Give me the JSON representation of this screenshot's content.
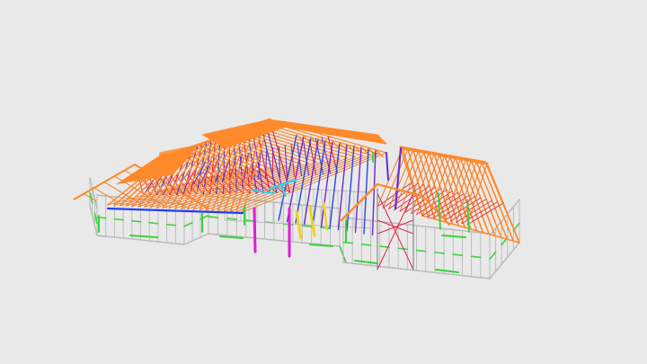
{
  "viewer": {
    "background": "#e9e9e9"
  },
  "colors": {
    "stud": "#b9b9b9",
    "stud_dark": "#8e8e8e",
    "truss_chord": "#f07b2a",
    "truss_top": "#ff8a2b",
    "web_purple": "#6a2bd6",
    "web_blue": "#2948e0",
    "web_red": "#e0234a",
    "brace_green": "#3ad23a",
    "post_magenta": "#e21cd6",
    "accent_cyan": "#2fd3e6",
    "accent_yellow": "#f0d21a",
    "beam_blue": "#1e3cff"
  }
}
